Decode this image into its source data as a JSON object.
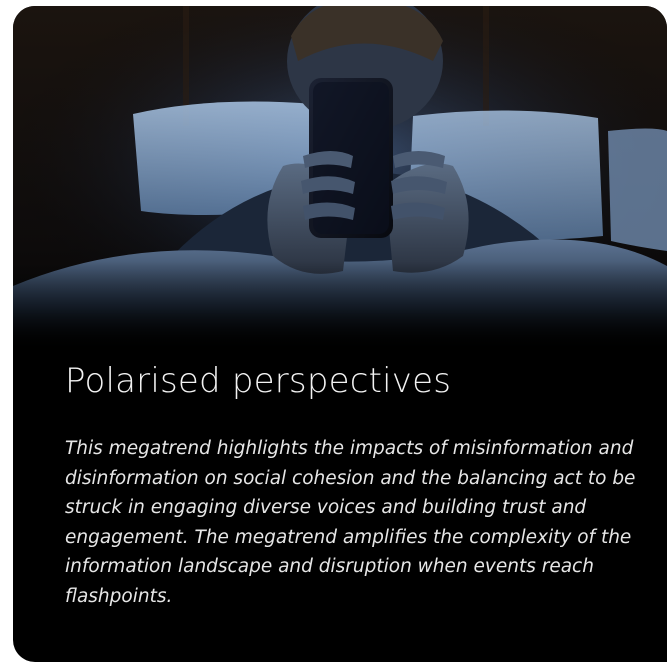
{
  "card": {
    "image_alt": "Person lying in bed at night looking at a glowing smartphone",
    "title": "Polarised perspectives",
    "description": "This megatrend highlights the impacts of misinformation and disinformation on social cohesion and the balancing act to be struck in engaging diverse voices and building trust and engagement. The megatrend amplifies the complexity of the information landscape and disruption when events reach flashpoints."
  },
  "colors": {
    "card_background": "#000000",
    "title_text": "#f2f2f2",
    "body_text": "#e6e6e6",
    "screen_glow": "#4f78b8"
  }
}
